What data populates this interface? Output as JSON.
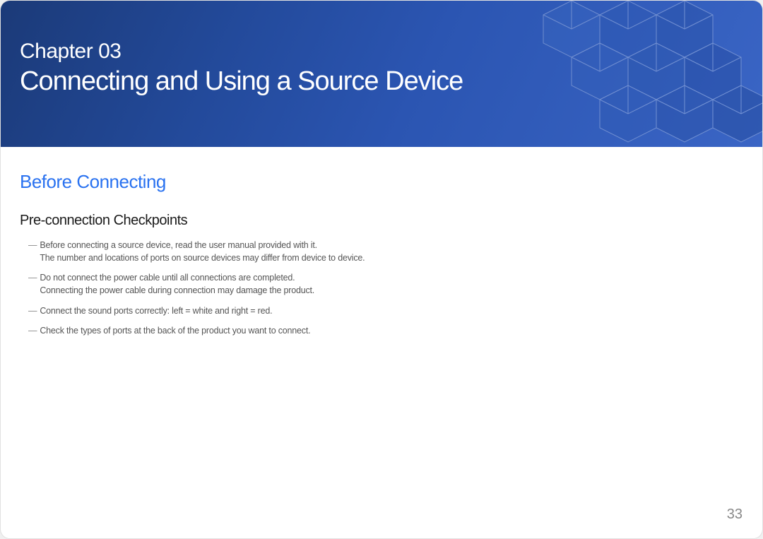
{
  "banner": {
    "chapter_label": "Chapter 03",
    "chapter_title": "Connecting and Using a Source Device"
  },
  "content": {
    "section_heading": "Before Connecting",
    "subsection_heading": "Pre-connection Checkpoints",
    "notes": [
      {
        "line1": "Before connecting a source device, read the user manual provided with it.",
        "line2": "The number and locations of ports on source devices may differ from device to device."
      },
      {
        "line1": "Do not connect the power cable until all connections are completed.",
        "line2": "Connecting the power cable during connection may damage the product."
      },
      {
        "line1": "Connect the sound ports correctly: left = white and right = red."
      },
      {
        "line1": "Check the types of ports at the back of the product you want to connect."
      }
    ]
  },
  "page_number": "33"
}
